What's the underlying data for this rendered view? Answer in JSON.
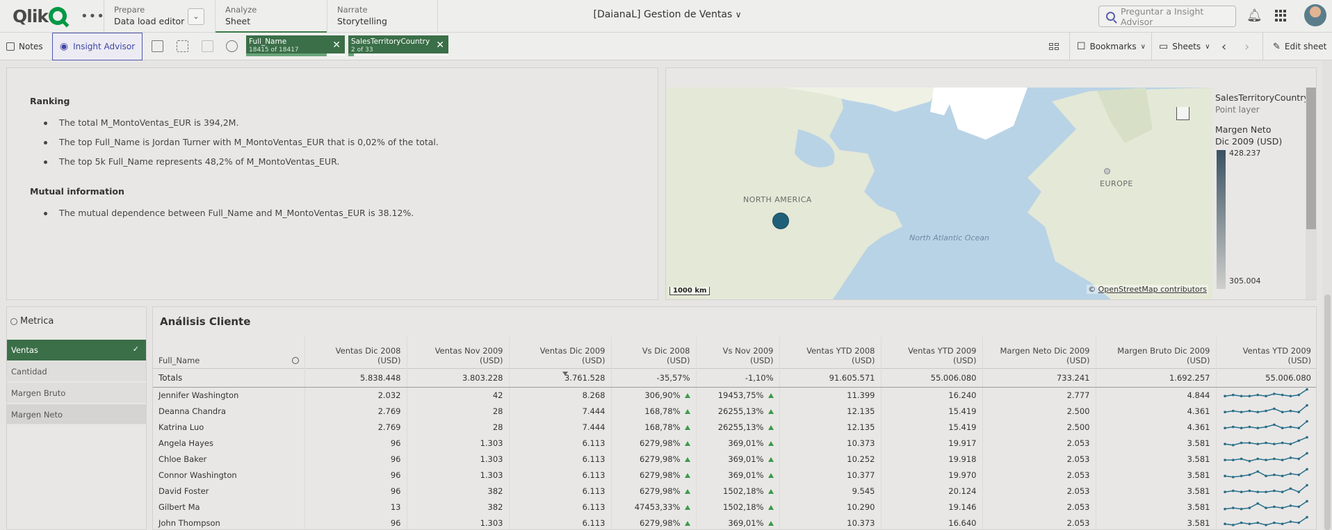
{
  "topbar": {
    "logo": "Qlik",
    "prepare": {
      "kicker": "Prepare",
      "value": "Data load editor"
    },
    "analyze": {
      "kicker": "Analyze",
      "value": "Sheet"
    },
    "narrate": {
      "kicker": "Narrate",
      "value": "Storytelling"
    },
    "app_title": "[DaianaL] Gestion de Ventas",
    "search_placeholder": "Preguntar a Insight Advisor"
  },
  "toolbar": {
    "notes": "Notes",
    "insight_advisor": "Insight Advisor",
    "bookmarks": "Bookmarks",
    "sheets": "Sheets",
    "edit_sheet": "Edit sheet",
    "chips": [
      {
        "field": "Full_Name",
        "count": "18415 of 18417",
        "fill": 0.99
      },
      {
        "field": "SalesTerritoryCountry",
        "count": "2 of 33",
        "fill": 0.06
      }
    ]
  },
  "insights": {
    "ranking_title": "Ranking",
    "ranking_items": [
      "The total M_MontoVentas_EUR is 394,2M.",
      "The top Full_Name is Jordan Turner with M_MontoVentas_EUR that is 0,02% of the total.",
      "The top 5k Full_Name represents 48,2% of M_MontoVentas_EUR."
    ],
    "mutual_title": "Mutual information",
    "mutual_items": [
      "The mutual dependence between Full_Name and M_MontoVentas_EUR is 38.12%."
    ]
  },
  "map": {
    "labels": {
      "north_america": "NORTH AMERICA",
      "europe": "EUROPE",
      "ocean": "North Atlantic Ocean"
    },
    "scale": "1000 km",
    "attribution_prefix": "©",
    "attribution_link": "OpenStreetMap contributors",
    "legend": {
      "title": "SalesTerritoryCountry",
      "subtitle": "Point layer",
      "measure": "Margen Neto Dic 2009 (USD)",
      "max": "428.237",
      "min": "305.004"
    },
    "colors": {
      "point": "#1f6078",
      "water": "#b9d3e6",
      "land": "#e8ecd8"
    }
  },
  "metric_list": {
    "title": "Metrica",
    "items": [
      {
        "label": "Ventas",
        "selected": true
      },
      {
        "label": "Cantidad",
        "selected": false
      },
      {
        "label": "Margen Bruto",
        "selected": false
      },
      {
        "label": "Margen Neto",
        "selected": false
      }
    ]
  },
  "table": {
    "title": "Análisis Cliente",
    "columns": [
      "Full_Name",
      "Ventas Dic 2008 (USD)",
      "Ventas Nov 2009 (USD)",
      "Ventas Dic 2009 (USD)",
      "Vs Dic 2008 (USD)",
      "Vs Nov 2009 (USD)",
      "Ventas YTD 2008 (USD)",
      "Ventas YTD 2009 (USD)",
      "Margen Neto Dic 2009 (USD)",
      "Margen Bruto Dic 2009 (USD)",
      "Ventas YTD 2009 (USD)"
    ],
    "totals": [
      "Totals",
      "5.838.448",
      "3.803.228",
      "3.761.528",
      "-35,57%",
      "-1,10%",
      "91.605.571",
      "55.006.080",
      "733.241",
      "1.692.257",
      "55.006.080"
    ],
    "rows": [
      {
        "cells": [
          "Jennifer Washington",
          "2.032",
          "42",
          "8.268",
          "306,90%",
          "19453,75%",
          "11.399",
          "16.240",
          "2.777",
          "4.844"
        ],
        "spark": [
          3,
          4,
          3,
          3,
          4,
          3,
          5,
          4,
          3,
          4,
          9
        ]
      },
      {
        "cells": [
          "Deanna Chandra",
          "2.769",
          "28",
          "7.444",
          "168,78%",
          "26255,13%",
          "12.135",
          "15.419",
          "2.500",
          "4.361"
        ],
        "spark": [
          3,
          4,
          3,
          4,
          3,
          4,
          6,
          3,
          4,
          3,
          9
        ]
      },
      {
        "cells": [
          "Katrina Luo",
          "2.769",
          "28",
          "7.444",
          "168,78%",
          "26255,13%",
          "12.135",
          "15.419",
          "2.500",
          "4.361"
        ],
        "spark": [
          3,
          4,
          3,
          4,
          3,
          4,
          6,
          3,
          4,
          3,
          9
        ]
      },
      {
        "cells": [
          "Angela Hayes",
          "96",
          "1.303",
          "6.113",
          "6279,98%",
          "369,01%",
          "10.373",
          "19.917",
          "2.053",
          "3.581"
        ],
        "spark": [
          3,
          2,
          4,
          4,
          3,
          4,
          3,
          4,
          3,
          6,
          9
        ]
      },
      {
        "cells": [
          "Chloe Baker",
          "96",
          "1.303",
          "6.113",
          "6279,98%",
          "369,01%",
          "10.252",
          "19.918",
          "2.053",
          "3.581"
        ],
        "spark": [
          3,
          3,
          4,
          2,
          4,
          3,
          4,
          3,
          5,
          4,
          9
        ]
      },
      {
        "cells": [
          "Connor Washington",
          "96",
          "1.303",
          "6.113",
          "6279,98%",
          "369,01%",
          "10.377",
          "19.970",
          "2.053",
          "3.581"
        ],
        "spark": [
          3,
          2,
          3,
          4,
          7,
          3,
          4,
          3,
          5,
          4,
          9
        ]
      },
      {
        "cells": [
          "David Foster",
          "96",
          "382",
          "6.113",
          "6279,98%",
          "1502,18%",
          "9.545",
          "20.124",
          "2.053",
          "3.581"
        ],
        "spark": [
          3,
          4,
          3,
          4,
          3,
          3,
          4,
          3,
          6,
          3,
          9
        ]
      },
      {
        "cells": [
          "Gilbert Ma",
          "13",
          "382",
          "6.113",
          "47453,33%",
          "1502,18%",
          "10.290",
          "19.146",
          "2.053",
          "3.581"
        ],
        "spark": [
          2,
          3,
          2,
          3,
          7,
          3,
          4,
          3,
          5,
          4,
          9
        ]
      },
      {
        "cells": [
          "John Thompson",
          "96",
          "1.303",
          "6.113",
          "6279,98%",
          "369,01%",
          "10.373",
          "16.640",
          "2.053",
          "3.581"
        ],
        "spark": [
          3,
          2,
          4,
          3,
          4,
          2,
          4,
          3,
          5,
          4,
          9
        ]
      }
    ]
  }
}
